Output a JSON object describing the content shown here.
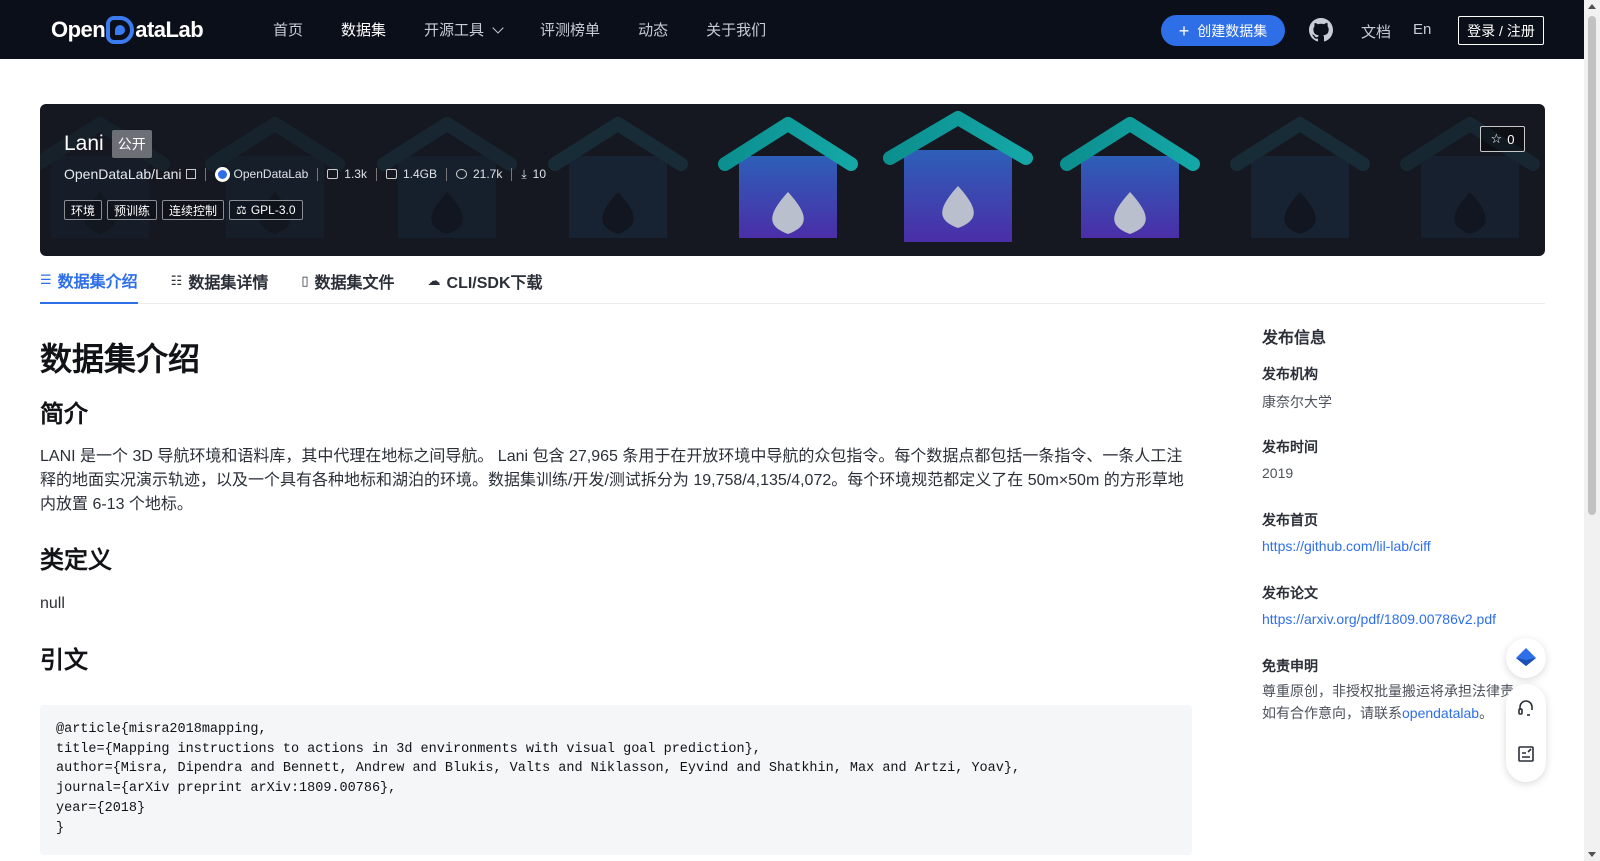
{
  "nav": {
    "logo": "OpenDataLab",
    "menu": [
      "首页",
      "数据集",
      "开源工具",
      "评测榜单",
      "动态",
      "关于我们"
    ],
    "active": "数据集",
    "create_label": "创建数据集",
    "docs": "文档",
    "lang": "En",
    "login": "登录 / 注册"
  },
  "dataset": {
    "name": "Lani",
    "visibility": "公开",
    "path": "OpenDataLab/Lani",
    "org": "OpenDataLab",
    "files": "1.3k",
    "size": "1.4GB",
    "views": "21.7k",
    "downloads": "10",
    "tags": [
      "环境",
      "预训练",
      "连续控制"
    ],
    "license": "GPL-3.0",
    "stars": "0"
  },
  "tabs": [
    "数据集介绍",
    "数据集详情",
    "数据集文件",
    "CLI/SDK下载"
  ],
  "content": {
    "title": "数据集介绍",
    "intro_heading": "简介",
    "intro_text": "LANI 是一个 3D 导航环境和语料库，其中代理在地标之间导航。 Lani 包含 27,965 条用于在开放环境中导航的众包指令。每个数据点都包括一条指令、一条人工注释的地面实况演示轨迹，以及一个具有各种地标和湖泊的环境。数据集训练/开发/测试拆分为 19,758/4,135/4,072。每个环境规范都定义了在 50m×50m 的方形草地内放置 6-13 个地标。",
    "classes_heading": "类定义",
    "classes_text": "null",
    "citation_heading": "引文",
    "citation": "@article{misra2018mapping,\ntitle={Mapping instructions to actions in 3d environments with visual goal prediction},\nauthor={Misra, Dipendra and Bennett, Andrew and Blukis, Valts and Niklasson, Eyvind and Shatkhin, Max and Artzi, Yoav},\njournal={arXiv preprint arXiv:1809.00786},\nyear={2018}\n}"
  },
  "sidebar": {
    "title": "发布信息",
    "org_label": "发布机构",
    "org_value": "康奈尔大学",
    "time_label": "发布时间",
    "time_value": "2019",
    "home_label": "发布首页",
    "home_value": "https://github.com/lil-lab/ciff",
    "paper_label": "发布论文",
    "paper_value": "https://arxiv.org/pdf/1809.00786v2.pdf",
    "disclaimer_label": "免责申明",
    "disclaimer_line1": "尊重原创，非授权批量搬运将承担法律责",
    "disclaimer_line2": "如有合作意向，请联系",
    "disclaimer_link": "opendatalab",
    "disclaimer_end": "。"
  },
  "colors": {
    "accent": "#2e6fe8",
    "nav_bg": "#0b0f1a"
  }
}
